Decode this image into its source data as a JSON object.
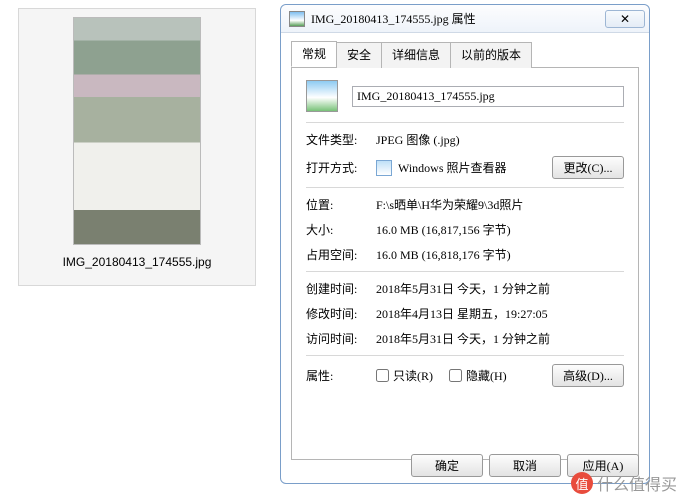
{
  "thumbnail": {
    "filename": "IMG_20180413_174555.jpg"
  },
  "dialog": {
    "title": "IMG_20180413_174555.jpg 属性",
    "close_glyph": "✕",
    "tabs": [
      {
        "label": "常规",
        "active": true
      },
      {
        "label": "安全",
        "active": false
      },
      {
        "label": "详细信息",
        "active": false
      },
      {
        "label": "以前的版本",
        "active": false
      }
    ],
    "filename_value": "IMG_20180413_174555.jpg",
    "fields": {
      "filetype_label": "文件类型:",
      "filetype_value": "JPEG 图像 (.jpg)",
      "openwith_label": "打开方式:",
      "openwith_app": "Windows 照片查看器",
      "change_button": "更改(C)...",
      "location_label": "位置:",
      "location_value": "F:\\s晒单\\H华为荣耀9\\3d照片",
      "size_label": "大小:",
      "size_value": "16.0 MB (16,817,156 字节)",
      "disksize_label": "占用空间:",
      "disksize_value": "16.0 MB (16,818,176 字节)",
      "created_label": "创建时间:",
      "created_value": "2018年5月31日 今天，1 分钟之前",
      "modified_label": "修改时间:",
      "modified_value": "2018年4月13日 星期五，19:27:05",
      "accessed_label": "访问时间:",
      "accessed_value": "2018年5月31日 今天，1 分钟之前",
      "attributes_label": "属性:",
      "readonly_label": "只读(R)",
      "hidden_label": "隐藏(H)",
      "advanced_button": "高级(D)..."
    },
    "buttons": {
      "ok": "确定",
      "cancel": "取消",
      "apply": "应用(A)"
    }
  },
  "watermark": {
    "badge": "值",
    "text": "什么值得买"
  }
}
